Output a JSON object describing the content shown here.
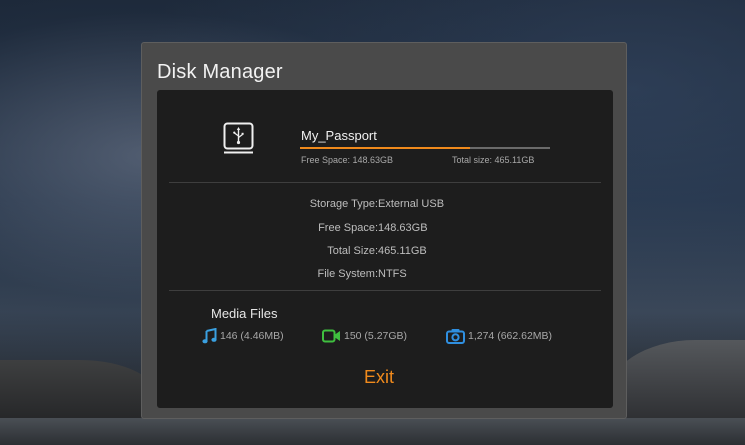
{
  "dialog": {
    "title": "Disk Manager"
  },
  "disk": {
    "name": "My_Passport",
    "used_fraction": 0.68,
    "free_space_label": "Free Space: 148.63GB",
    "total_size_label": "Total size: 465.11GB",
    "icon": "usb-drive-icon"
  },
  "details": [
    {
      "label": "Storage Type:",
      "value": "External USB"
    },
    {
      "label": "Free Space:",
      "value": "148.63GB"
    },
    {
      "label": "Total Size:",
      "value": "465.11GB"
    },
    {
      "label": "File System:",
      "value": "NTFS"
    }
  ],
  "media": {
    "title": "Media Files",
    "music": {
      "icon": "music-note-icon",
      "text": "146 (4.46MB)"
    },
    "video": {
      "icon": "video-camera-icon",
      "text": "150 (5.27GB)"
    },
    "photo": {
      "icon": "photo-camera-icon",
      "text": "1,274 (662.62MB)"
    }
  },
  "actions": {
    "exit_label": "Exit"
  },
  "colors": {
    "accent": "#f08a1c",
    "icon_music": "#3aa0e0",
    "icon_video": "#3fbf3f",
    "icon_photo": "#2f8fe0"
  }
}
